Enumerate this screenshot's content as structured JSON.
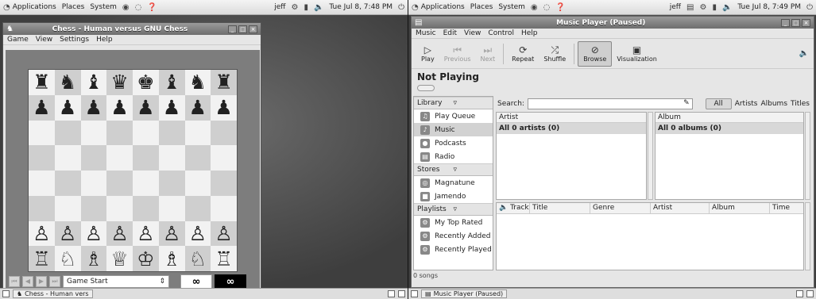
{
  "left": {
    "panel": {
      "applications": "Applications",
      "places": "Places",
      "system": "System",
      "user": "jeff",
      "clock": "Tue Jul 8, 7:48 PM"
    },
    "chess": {
      "title": "Chess - Human versus GNU Chess",
      "menus": [
        "Game",
        "View",
        "Settings",
        "Help"
      ],
      "rows": [
        [
          "♜",
          "♞",
          "♝",
          "♛",
          "♚",
          "♝",
          "♞",
          "♜"
        ],
        [
          "♟",
          "♟",
          "♟",
          "♟",
          "♟",
          "♟",
          "♟",
          "♟"
        ],
        [
          "",
          "",
          "",
          "",
          "",
          "",
          "",
          ""
        ],
        [
          "",
          "",
          "",
          "",
          "",
          "",
          "",
          ""
        ],
        [
          "",
          "",
          "",
          "",
          "",
          "",
          "",
          ""
        ],
        [
          "",
          "",
          "",
          "",
          "",
          "",
          "",
          ""
        ],
        [
          "♙",
          "♙",
          "♙",
          "♙",
          "♙",
          "♙",
          "♙",
          "♙"
        ],
        [
          "♖",
          "♘",
          "♗",
          "♕",
          "♔",
          "♗",
          "♘",
          "♖"
        ]
      ],
      "move_combo": "Game Start",
      "clock_white": "∞",
      "clock_black": "∞"
    },
    "taskbar": {
      "task": "Chess - Human vers"
    }
  },
  "right": {
    "panel": {
      "applications": "Applications",
      "places": "Places",
      "system": "System",
      "user": "jeff",
      "clock": "Tue Jul 8, 7:49 PM"
    },
    "music": {
      "title": "Music Player (Paused)",
      "menus": [
        "Music",
        "Edit",
        "View",
        "Control",
        "Help"
      ],
      "toolbar": [
        {
          "label": "Play",
          "icon": "▷",
          "state": "normal"
        },
        {
          "label": "Previous",
          "icon": "⏮",
          "state": "disabled"
        },
        {
          "label": "Next",
          "icon": "⏭",
          "state": "disabled"
        },
        {
          "label": "Repeat",
          "icon": "⟳",
          "state": "normal"
        },
        {
          "label": "Shuffle",
          "icon": "⤮",
          "state": "normal"
        },
        {
          "label": "Browse",
          "icon": "⊘",
          "state": "active"
        },
        {
          "label": "Visualization",
          "icon": "▣",
          "state": "normal"
        }
      ],
      "now_playing": "Not Playing",
      "sidebar": {
        "library_header": "Library",
        "library_items": [
          {
            "label": "Play Queue",
            "icon": "♫"
          },
          {
            "label": "Music",
            "icon": "♪"
          },
          {
            "label": "Podcasts",
            "icon": "●"
          },
          {
            "label": "Radio",
            "icon": "▤"
          }
        ],
        "stores_header": "Stores",
        "stores_items": [
          {
            "label": "Magnatune",
            "icon": "◎"
          },
          {
            "label": "Jamendo",
            "icon": "■"
          }
        ],
        "playlists_header": "Playlists",
        "playlist_items": [
          {
            "label": "My Top Rated",
            "icon": "⚙"
          },
          {
            "label": "Recently Added",
            "icon": "⚙"
          },
          {
            "label": "Recently Played",
            "icon": "⚙"
          }
        ]
      },
      "search_label": "Search:",
      "filters": [
        "All",
        "Artists",
        "Albums",
        "Titles"
      ],
      "artist_header": "Artist",
      "artist_all": "All 0 artists (0)",
      "album_header": "Album",
      "album_all": "All 0 albums (0)",
      "track_columns": [
        "Track",
        "Title",
        "Genre",
        "Artist",
        "Album",
        "Time"
      ],
      "status": "0 songs"
    },
    "taskbar": {
      "task": "Music Player (Paused)"
    }
  }
}
